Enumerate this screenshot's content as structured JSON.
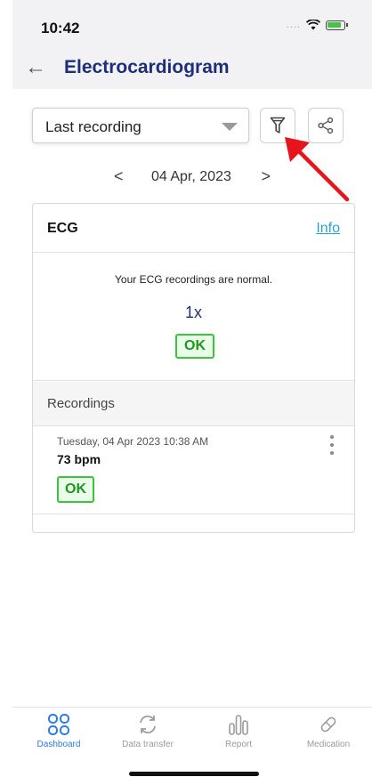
{
  "status_bar": {
    "time": "10:42",
    "signal": "....",
    "wifi_icon": "wifi-icon",
    "battery_icon": "battery-charging-icon"
  },
  "header": {
    "back_icon": "back-arrow-icon",
    "title": "Electrocardiogram"
  },
  "toolbar": {
    "range_selected": "Last recording",
    "filter_icon": "filter-icon",
    "share_icon": "share-icon"
  },
  "date_nav": {
    "prev_label": "<",
    "date": "04 Apr, 2023",
    "next_label": ">"
  },
  "card": {
    "title": "ECG",
    "info_label": "Info",
    "summary_text": "Your ECG recordings are normal.",
    "summary_count": "1x",
    "summary_status": "OK",
    "recordings_title": "Recordings",
    "recordings": [
      {
        "datetime": "Tuesday, 04 Apr 2023 10:38 AM",
        "bpm": "73 bpm",
        "status": "OK"
      }
    ]
  },
  "tabs": [
    {
      "label": "Dashboard",
      "icon": "dashboard-icon",
      "active": true
    },
    {
      "label": "Data transfer",
      "icon": "sync-icon",
      "active": false
    },
    {
      "label": "Report",
      "icon": "report-chart-icon",
      "active": false
    },
    {
      "label": "Medication",
      "icon": "pill-icon",
      "active": false
    }
  ],
  "colors": {
    "title": "#1d2f7a",
    "info_link": "#2aa3d8",
    "ok_border": "#3cc43c",
    "active_tab": "#2c7be5",
    "annotation_arrow": "#e8141b"
  }
}
